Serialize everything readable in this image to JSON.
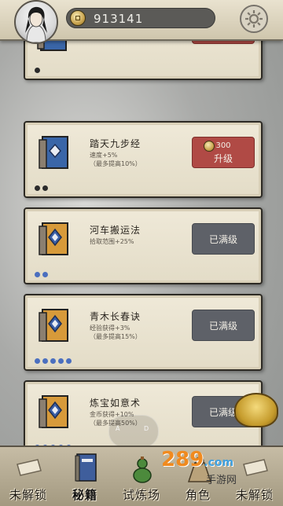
{
  "header": {
    "coins": "913141"
  },
  "skills": [
    {
      "name": "",
      "desc1": "",
      "desc2": "",
      "book_color": "#3a66a8",
      "dots": 1,
      "dot_color": "#2b2b2b",
      "button": "partial"
    },
    {
      "name": "踏天九步经",
      "desc1": "速度+5%",
      "desc2": "（最多提高10%）",
      "book_color": "#3a66a8",
      "dots": 2,
      "dot_color": "#2b2b2b",
      "button": "upgrade",
      "price": "300",
      "button_label": "升级"
    },
    {
      "name": "河车搬运法",
      "desc1": "拾取范围+25%",
      "desc2": "",
      "book_color": "#d79a3a",
      "dots": 2,
      "dot_color": "#4b6fbf",
      "button": "maxed",
      "button_label": "已满级"
    },
    {
      "name": "青木长春诀",
      "desc1": "经验获得+3%",
      "desc2": "（最多提高15%）",
      "book_color": "#d79a3a",
      "dots": 5,
      "dot_color": "#4b6fbf",
      "button": "maxed",
      "button_label": "已满级"
    },
    {
      "name": "炼宝如意术",
      "desc1": "金币获得+10%",
      "desc2": "（最多提高50%）",
      "book_color": "#d79a3a",
      "dots": 5,
      "dot_color": "#4b6fbf",
      "button": "maxed",
      "button_label": "已满级"
    }
  ],
  "joystick": {
    "left": "A",
    "right": "D"
  },
  "nav": [
    {
      "label": "未解锁",
      "icon": "scroll-locked-icon",
      "active": false
    },
    {
      "label": "秘籍",
      "icon": "book-icon",
      "active": true
    },
    {
      "label": "试炼场",
      "icon": "gourd-icon",
      "active": false
    },
    {
      "label": "角色",
      "icon": "character-icon",
      "active": false
    },
    {
      "label": "未解锁",
      "icon": "scroll-locked-icon",
      "active": false
    }
  ],
  "watermark": {
    "brand": "289",
    "suffix": ".com",
    "sub": "手游网"
  },
  "colors": {
    "upgrade": "#b04a45",
    "maxed": "#5e6168",
    "card": "#efe9d8"
  }
}
